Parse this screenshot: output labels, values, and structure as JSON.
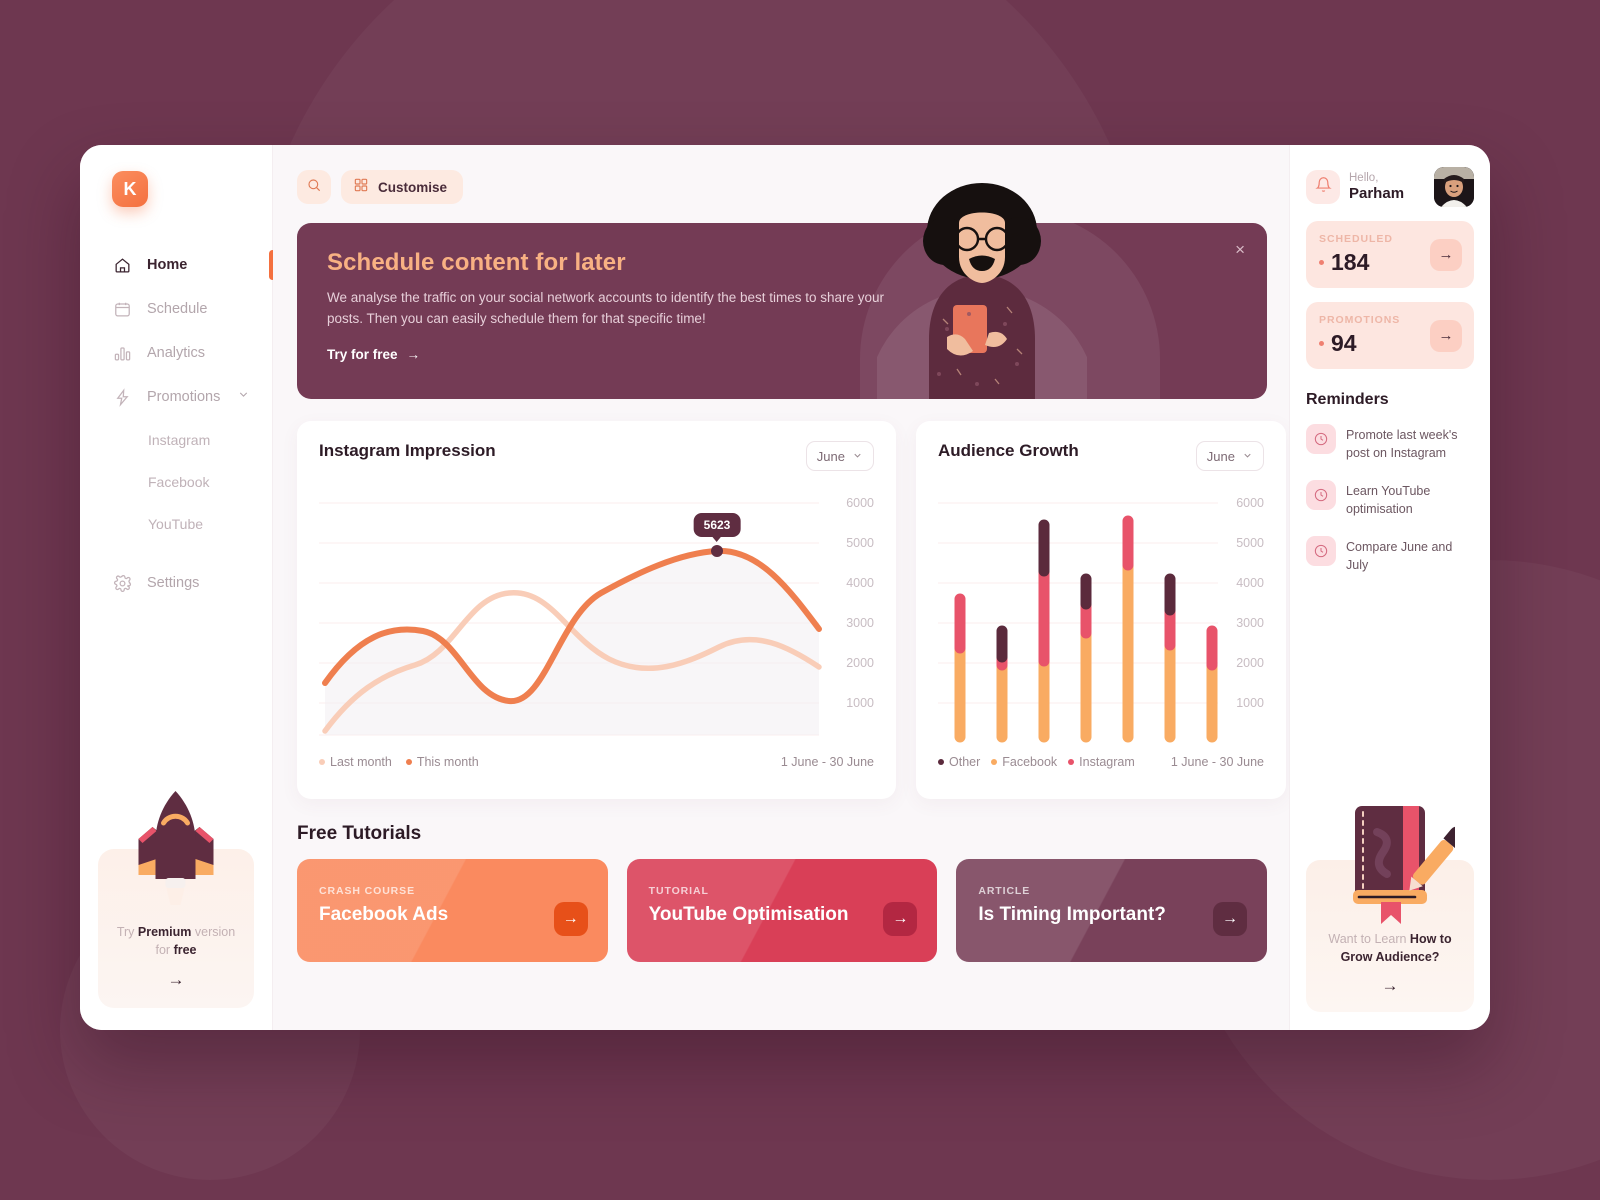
{
  "brand": {
    "logo_letter": "K"
  },
  "sidebar": {
    "items": [
      {
        "label": "Home",
        "icon": "home-icon",
        "active": true
      },
      {
        "label": "Schedule",
        "icon": "calendar-icon",
        "active": false
      },
      {
        "label": "Analytics",
        "icon": "bar-chart-icon",
        "active": false
      },
      {
        "label": "Promotions",
        "icon": "bolt-icon",
        "active": false,
        "expandable": true
      }
    ],
    "sub_items": [
      "Instagram",
      "Facebook",
      "YouTube"
    ],
    "settings": {
      "label": "Settings",
      "icon": "gear-icon"
    },
    "premium": {
      "line1_pre": "Try ",
      "line1_strong": "Premium",
      "line1_post": " version",
      "line2_pre": "for ",
      "line2_strong": "free",
      "arrow": "→"
    }
  },
  "topbar": {
    "search_icon": "search-icon",
    "customise_label": "Customise",
    "customise_icon": "grid-icon"
  },
  "banner": {
    "title": "Schedule content for later",
    "body": "We analyse the traffic on your social network accounts to identify the best times to share your posts. Then you can easily schedule them for that specific time!",
    "cta": "Try for free",
    "cta_arrow": "→",
    "close": "×"
  },
  "charts": {
    "impression": {
      "title": "Instagram Impression",
      "period_select": "June",
      "legend": [
        {
          "label": "Last month",
          "color": "#f9cdb8"
        },
        {
          "label": "This month",
          "color": "#ef7f4f"
        }
      ],
      "range": "1 June - 30 June",
      "tooltip_value": "5623"
    },
    "audience": {
      "title": "Audience Growth",
      "period_select": "June",
      "legend": [
        {
          "label": "Other",
          "color": "#5b2a3c"
        },
        {
          "label": "Facebook",
          "color": "#f9ab62"
        },
        {
          "label": "Instagram",
          "color": "#e8536a"
        }
      ],
      "range": "1 June - 30 June"
    }
  },
  "chart_data": [
    {
      "type": "line",
      "title": "Instagram Impression",
      "xlabel": "",
      "ylabel": "",
      "ylim": [
        0,
        6500
      ],
      "yticks": [
        6000,
        5000,
        4000,
        3000,
        2000,
        1000
      ],
      "grid": true,
      "legend_position": "bottom-left",
      "x": [
        1,
        5,
        9,
        13,
        17,
        21,
        25,
        30
      ],
      "annotations": [
        {
          "label": "5623",
          "x": 25,
          "y": 5623
        }
      ],
      "series": [
        {
          "name": "This month",
          "color": "#ef7f4f",
          "values": [
            2100,
            3200,
            3150,
            1900,
            1850,
            3600,
            5623,
            3900
          ]
        },
        {
          "name": "Last month",
          "color": "#f9cdb8",
          "values": [
            600,
            2150,
            2500,
            3450,
            3450,
            2400,
            2900,
            2650
          ]
        }
      ]
    },
    {
      "type": "bar",
      "title": "Audience Growth",
      "xlabel": "",
      "ylabel": "",
      "ylim": [
        0,
        6500
      ],
      "yticks": [
        6000,
        5000,
        4000,
        3000,
        2000,
        1000
      ],
      "grid": true,
      "stacked": true,
      "legend_position": "bottom-left",
      "categories": [
        "1",
        "2",
        "3",
        "4",
        "5",
        "6",
        "7"
      ],
      "series": [
        {
          "name": "Facebook",
          "color": "#f9ab62",
          "values": [
            2350,
            1900,
            2000,
            2700,
            4400,
            2400,
            1950
          ]
        },
        {
          "name": "Instagram",
          "color": "#e8536a",
          "values": [
            1150,
            200,
            2350,
            750,
            800,
            1050,
            750
          ]
        },
        {
          "name": "Other",
          "color": "#5b2a3c",
          "values": [
            0,
            650,
            1150,
            550,
            0,
            550,
            0
          ]
        }
      ]
    }
  ],
  "tutorials": {
    "section_title": "Free Tutorials",
    "cards": [
      {
        "kicker": "CRASH COURSE",
        "title": "Facebook Ads",
        "bg": "#fa8a5f",
        "btn_bg": "#e75019",
        "arrow": "→"
      },
      {
        "kicker": "TUTORIAL",
        "title": "YouTube Optimisation",
        "bg": "#d93f57",
        "btn_bg": "#b32742",
        "arrow": "→"
      },
      {
        "kicker": "ARTICLE",
        "title": "Is Timing Important?",
        "bg": "#79415a",
        "btn_bg": "#5f2d41",
        "arrow": "→"
      }
    ]
  },
  "rail": {
    "bell_icon": "bell-icon",
    "greeting": "Hello,",
    "user_name": "Parham",
    "stats": [
      {
        "key": "SCHEDULED",
        "value": "184",
        "arrow": "→"
      },
      {
        "key": "PROMOTIONS",
        "value": "94",
        "arrow": "→"
      }
    ],
    "reminders_title": "Reminders",
    "reminders": [
      "Promote last week's post on Instagram",
      "Learn YouTube optimisation",
      "Compare June and July"
    ],
    "grow": {
      "line1_pre": "Want to Learn ",
      "line1_strong": "How to",
      "line2_strong": "Grow Audience?",
      "arrow": "→"
    }
  },
  "colors": {
    "backdrop": "#6e3750",
    "accent_orange": "#f4703f",
    "accent_pink": "#e8536a",
    "plum": "#5f2d41"
  }
}
